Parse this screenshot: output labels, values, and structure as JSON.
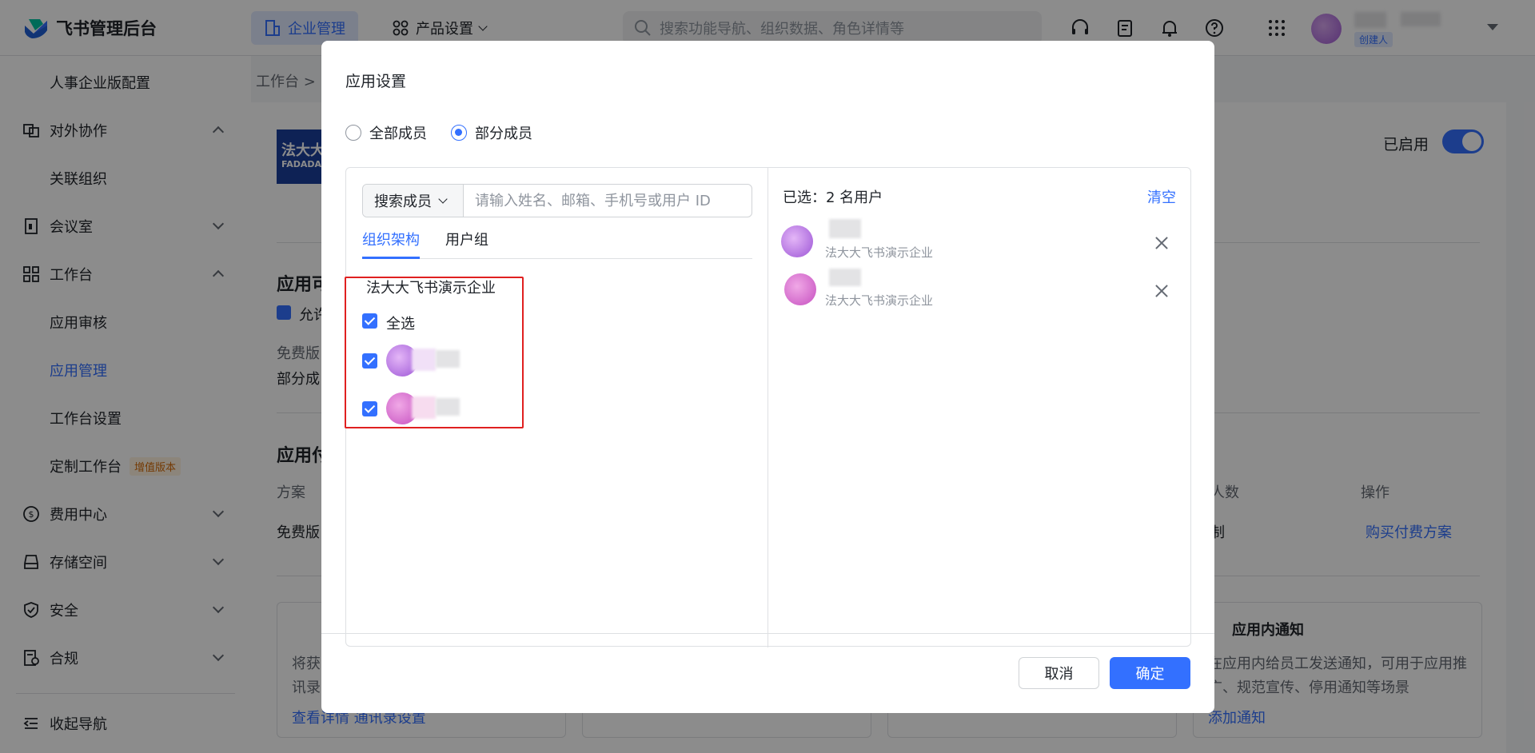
{
  "topbar": {
    "brand": "飞书管理后台",
    "nav_active": "企业管理",
    "nav_product": "产品设置",
    "search_placeholder": "搜索功能导航、组织数据、角色详情等",
    "creator_badge": "创建人"
  },
  "sidebar": {
    "items": [
      {
        "label": "人事企业版配置"
      },
      {
        "label": "对外协作"
      },
      {
        "label": "关联组织"
      },
      {
        "label": "会议室"
      },
      {
        "label": "工作台"
      },
      {
        "label": "应用审核"
      },
      {
        "label": "应用管理"
      },
      {
        "label": "工作台设置"
      },
      {
        "label": "定制工作台"
      },
      {
        "label": "费用中心"
      },
      {
        "label": "存储空间"
      },
      {
        "label": "安全"
      },
      {
        "label": "合规"
      }
    ],
    "upgrade_tag": "增值版本",
    "collapse": "收起导航"
  },
  "background": {
    "breadcrumb": "工作台 >",
    "app_logo_cn": "法大大",
    "app_logo_en": "FADADA",
    "enabled_label": "已启用",
    "section1_title": "应用可",
    "allow_label": "允许",
    "free_label": "免费版",
    "partial_label": "部分成",
    "section2_title": "应用付",
    "col_plan": "方案",
    "col_people": "人数",
    "col_action": "操作",
    "row_plan": "免费版",
    "row_people": "制",
    "buy_link": "购买付费方案",
    "box1_line1": "将获",
    "box1_line2": "讯录",
    "box1_link": "查看详情  通讯录设置",
    "box4_title": "应用内通知",
    "box4_line1": "在应用内给员工发送通知，可用于应用推",
    "box4_line2": "广、规范宣传、停用通知等场景",
    "box4_link": "添加通知"
  },
  "modal": {
    "title": "应用设置",
    "radio_all": "全部成员",
    "radio_partial": "部分成员",
    "search_type": "搜索成员",
    "search_placeholder": "请输入姓名、邮箱、手机号或用户 ID",
    "tab_org": "组织架构",
    "tab_group": "用户组",
    "org_name": "法大大飞书演示企业",
    "select_all": "全选",
    "selected_title": "已选：2 名用户",
    "clear": "清空",
    "selected_users": [
      {
        "org": "法大大飞书演示企业"
      },
      {
        "org": "法大大飞书演示企业"
      }
    ],
    "cancel": "取消",
    "confirm": "确定"
  },
  "colors": {
    "primary": "#3370ff",
    "highlight_box": "#e02020",
    "upgrade_tag": "#d46b08"
  }
}
